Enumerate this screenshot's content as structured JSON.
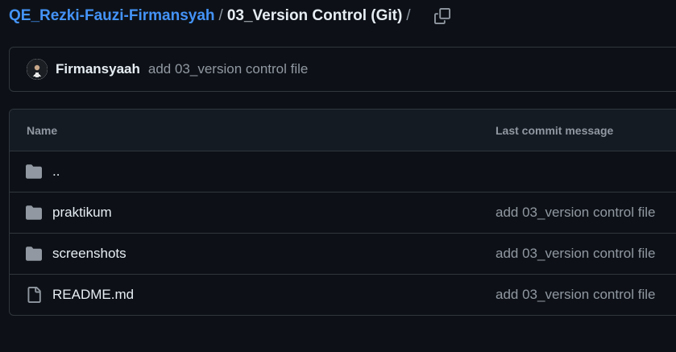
{
  "breadcrumb": {
    "repo": "QE_Rezki-Fauzi-Firmansyah",
    "separator": "/",
    "current": "03_Version Control (Git)",
    "trailing_separator": "/"
  },
  "copy_icon": "copy-icon",
  "latest_commit": {
    "author": "Firmansyaah",
    "message": "add 03_version control file",
    "avatar_icon": "avatar"
  },
  "table": {
    "headers": {
      "name": "Name",
      "last_commit_message": "Last commit message"
    },
    "rows": [
      {
        "icon": "folder-icon",
        "name": "..",
        "message": ""
      },
      {
        "icon": "folder-icon",
        "name": "praktikum",
        "message": "add 03_version control file"
      },
      {
        "icon": "folder-icon",
        "name": "screenshots",
        "message": "add 03_version control file"
      },
      {
        "icon": "file-icon",
        "name": "README.md",
        "message": "add 03_version control file"
      }
    ]
  },
  "colors": {
    "background": "#0d1117",
    "link": "#4493f8",
    "muted": "#9198a1",
    "border": "#30363d",
    "header_bg": "#151b23"
  }
}
